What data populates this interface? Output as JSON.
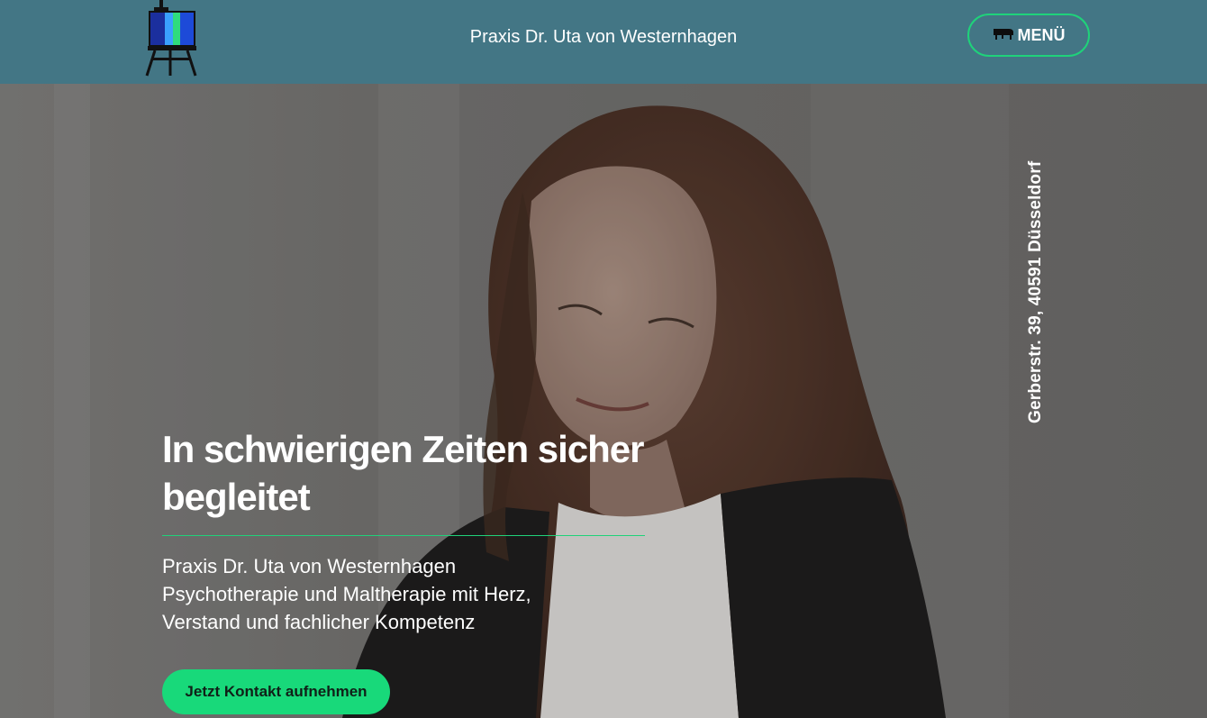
{
  "header": {
    "site_title": "Praxis Dr. Uta von Westernhagen",
    "menu_label": "MENÜ",
    "logo_icon": "easel-painting-icon",
    "menu_icon": "piano-icon"
  },
  "hero": {
    "address": "Gerberstr. 39, 40591 Düsseldorf",
    "heading": "In schwierigen Zeiten sicher begleitet",
    "subtitle_lines": [
      "Praxis Dr. Uta von Westernhagen",
      "Psychotherapie und Maltherapie mit Herz,",
      "Verstand und fachlicher Kompetenz"
    ],
    "cta_label": "Jetzt Kontakt aufnehmen"
  },
  "colors": {
    "header_bg": "#437685",
    "accent": "#1fd27a",
    "cta_bg": "#18d97a"
  }
}
